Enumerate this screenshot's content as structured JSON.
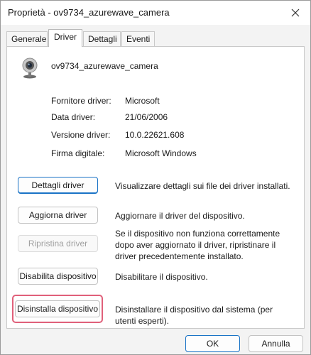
{
  "window": {
    "title": "Proprietà - ov9734_azurewave_camera"
  },
  "tabs": [
    {
      "label": "Generale"
    },
    {
      "label": "Driver",
      "active": true
    },
    {
      "label": "Dettagli"
    },
    {
      "label": "Eventi"
    }
  ],
  "device": {
    "name": "ov9734_azurewave_camera",
    "icon": "webcam-icon"
  },
  "properties": {
    "provider": {
      "label": "Fornitore driver:",
      "value": "Microsoft"
    },
    "date": {
      "label": "Data driver:",
      "value": "21/06/2006"
    },
    "version": {
      "label": "Versione driver:",
      "value": "10.0.22621.608"
    },
    "signer": {
      "label": "Firma digitale:",
      "value": "Microsoft Windows"
    }
  },
  "actions": [
    {
      "label": "Dettagli driver",
      "description": "Visualizzare dettagli sui file dei driver installati.",
      "enabled": true
    },
    {
      "label": "Aggiorna driver",
      "description": "Aggiornare il driver del dispositivo.",
      "enabled": true
    },
    {
      "label": "Ripristina driver",
      "description": "Se il dispositivo non funziona correttamente dopo aver aggiornato il driver, ripristinare il driver precedentemente installato.",
      "enabled": false
    },
    {
      "label": "Disabilita dispositivo",
      "description": "Disabilitare il dispositivo.",
      "enabled": true
    },
    {
      "label": "Disinstalla dispositivo",
      "description": "Disinstallare il dispositivo dal sistema (per utenti esperti).",
      "enabled": true,
      "highlighted": true
    }
  ],
  "footer": {
    "ok_label": "OK",
    "cancel_label": "Annulla"
  },
  "colors": {
    "accent": "#1a73c6",
    "highlight": "#e0607a"
  }
}
